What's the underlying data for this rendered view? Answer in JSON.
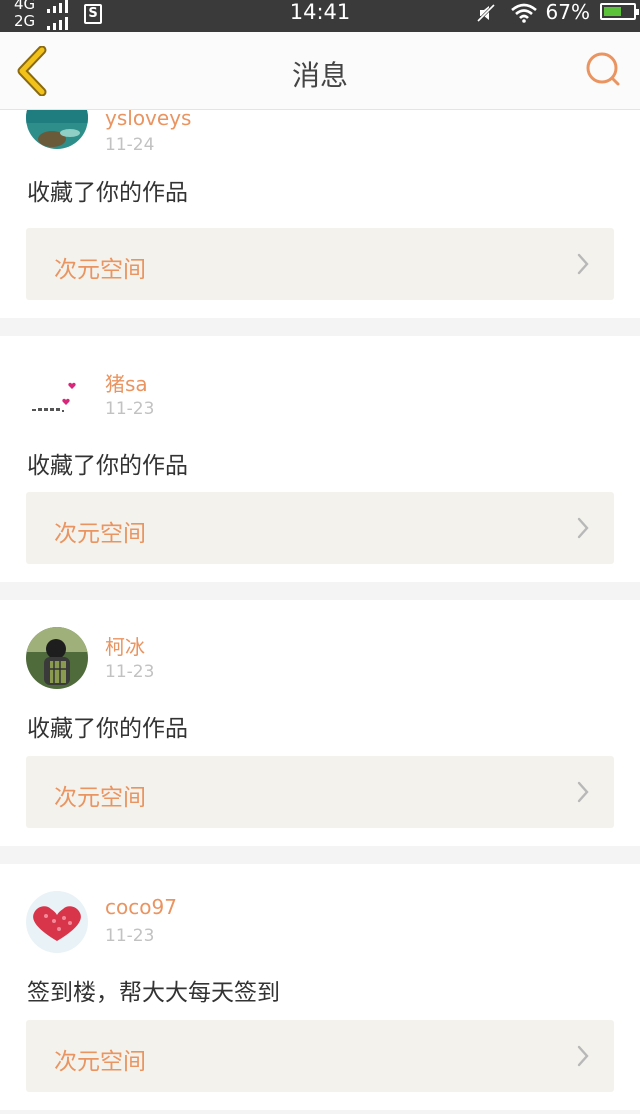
{
  "status_bar": {
    "network_1": "4G",
    "network_2": "2G",
    "sim_icon": "S",
    "time": "14:41",
    "battery": "67%",
    "battery_level": 0.67,
    "icons": [
      "signal-bars-icon",
      "sim-icon",
      "mute-icon",
      "wifi-icon",
      "battery-icon"
    ]
  },
  "header": {
    "title": "消息",
    "back_icon": "chevron-left-icon",
    "search_icon": "search-icon",
    "accent_color": "#ea9461"
  },
  "messages": [
    {
      "user": "ysloveys",
      "date": "11-24",
      "text": "收藏了你的作品",
      "link": "次元空间"
    },
    {
      "user": "猪sa",
      "date": "11-23",
      "text": "收藏了你的作品",
      "link": "次元空间"
    },
    {
      "user": "柯冰",
      "date": "11-23",
      "text": "收藏了你的作品",
      "link": "次元空间"
    },
    {
      "user": "coco97",
      "date": "11-23",
      "text": "签到楼，帮大大每天签到",
      "link": "次元空间"
    }
  ]
}
